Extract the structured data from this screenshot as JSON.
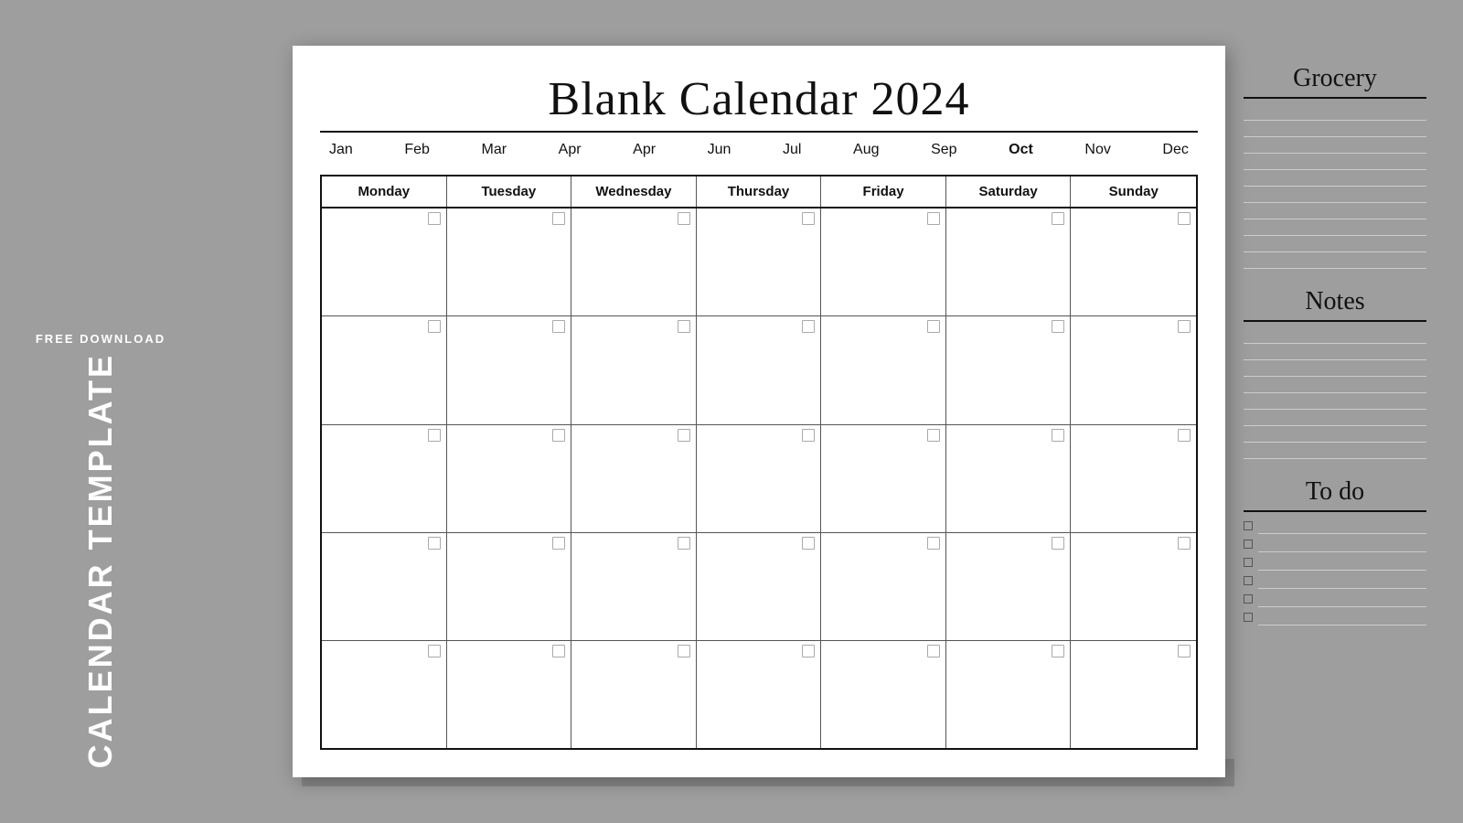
{
  "sidebar": {
    "free_download": "FREE DOWNLOAD",
    "calendar_template": "CALENDAR TEMPLATE"
  },
  "paper": {
    "title": "Blank Calendar 2024",
    "months": [
      "Jan",
      "Feb",
      "Mar",
      "Apr",
      "Apr",
      "Jun",
      "Jul",
      "Aug",
      "Sep",
      "Oct",
      "Nov",
      "Dec"
    ],
    "active_month": "Oct",
    "weekdays": [
      "Monday",
      "Tuesday",
      "Wednesday",
      "Thursday",
      "Friday",
      "Saturday",
      "Sunday"
    ],
    "rows": 5
  },
  "right_sidebar": {
    "grocery_title": "Grocery",
    "grocery_lines": 10,
    "notes_title": "Notes",
    "notes_lines": 8,
    "todo_title": "To do",
    "todo_items": 6
  }
}
